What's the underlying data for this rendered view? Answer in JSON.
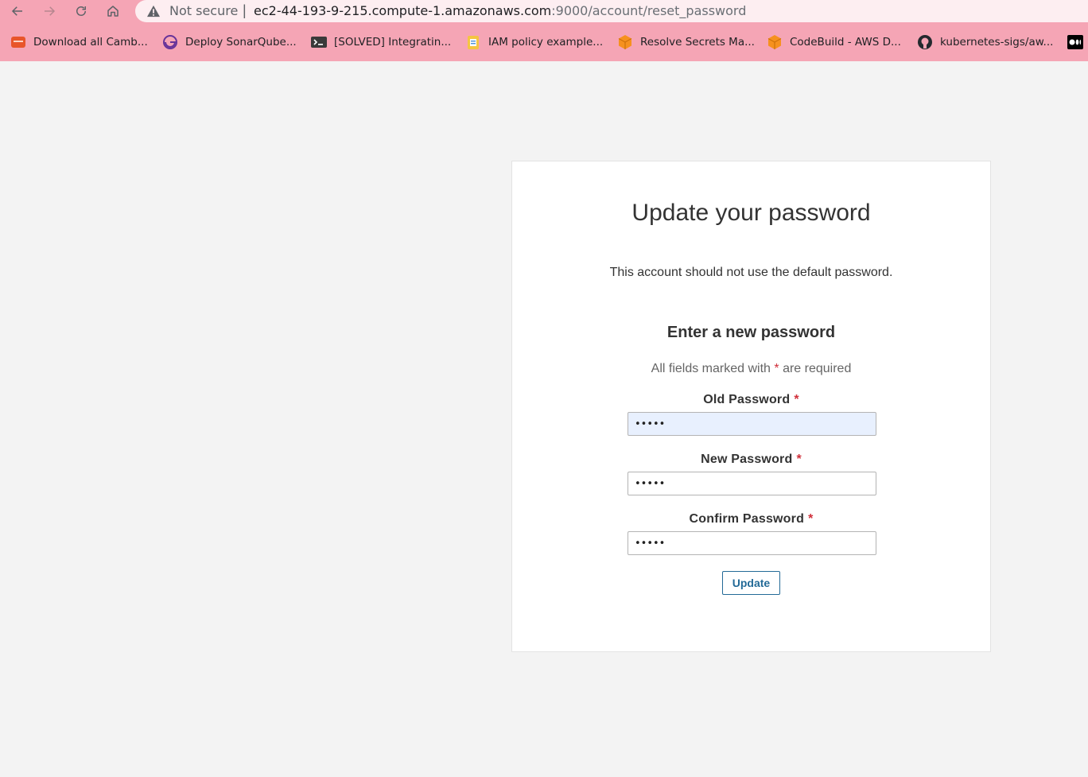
{
  "browser": {
    "security_label": "Not secure",
    "separator": "|",
    "url_host": "ec2-44-193-9-215.compute-1.amazonaws.com",
    "url_path": ":9000/account/reset_password",
    "bookmarks": [
      {
        "label": "Download all Camb...",
        "icon": "book-icon"
      },
      {
        "label": "Deploy SonarQube...",
        "icon": "gatsby-icon"
      },
      {
        "label": "[SOLVED] Integratin...",
        "icon": "terminal-icon"
      },
      {
        "label": "IAM policy example...",
        "icon": "notebook-icon"
      },
      {
        "label": "Resolve Secrets Ma...",
        "icon": "aws-cube-icon"
      },
      {
        "label": "CodeBuild - AWS D...",
        "icon": "aws-cube-icon"
      },
      {
        "label": "kubernetes-sigs/aw...",
        "icon": "github-icon"
      }
    ],
    "bookmark_overflow_icon": "medium-icon"
  },
  "form": {
    "title": "Update your password",
    "subtitle": "This account should not use the default password.",
    "section_title": "Enter a new password",
    "required_note_prefix": "All fields marked with",
    "required_marker": "*",
    "required_note_suffix": "are required",
    "fields": [
      {
        "label": "Old Password",
        "value": "•••••",
        "autofilled": true
      },
      {
        "label": "New Password",
        "value": "•••••",
        "autofilled": false
      },
      {
        "label": "Confirm Password",
        "value": "•••••",
        "autofilled": false
      }
    ],
    "submit_label": "Update"
  },
  "colors": {
    "chrome_bg": "#f5a5b5",
    "accent": "#236a97",
    "required": "#d02f3a"
  }
}
